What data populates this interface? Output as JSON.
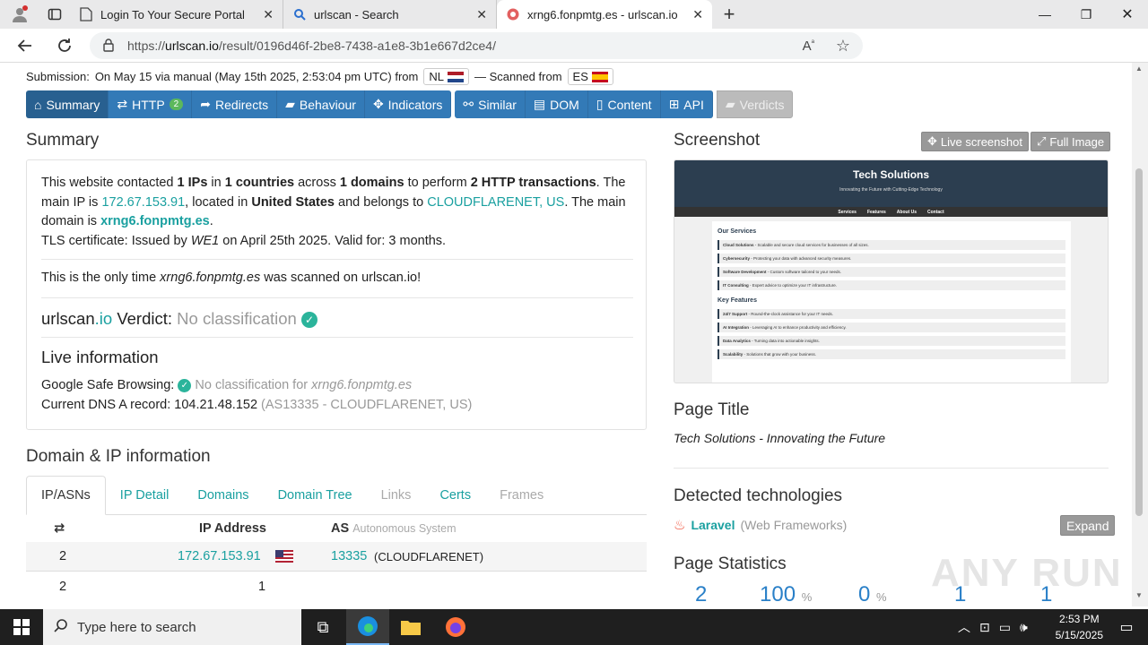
{
  "browser": {
    "tabs": [
      {
        "label": "Login To Your Secure Portal",
        "icon": "page-icon"
      },
      {
        "label": "urlscan - Search",
        "icon": "search-icon"
      },
      {
        "label": "xrng6.fonpmtg.es - urlscan.io",
        "icon": "urlscan-icon"
      }
    ],
    "url_prefix": "https://",
    "url_host": "urlscan.io",
    "url_path": "/result/0196d46f-2be8-7438-a1e8-3b1e667d2ce4/"
  },
  "submission": {
    "label": "Submission:",
    "text": "On May 15 via manual (May 15th 2025, 2:53:04 pm UTC) from",
    "from_country": "NL",
    "scanned_label": "— Scanned from",
    "scanned_country": "ES"
  },
  "nav_buttons": [
    {
      "label": "Summary",
      "icon": "home-icon"
    },
    {
      "label": "HTTP",
      "icon": "exchange-icon",
      "badge": "2"
    },
    {
      "label": "Redirects",
      "icon": "share-icon"
    },
    {
      "label": "Behaviour",
      "icon": "comment-icon"
    },
    {
      "label": "Indicators",
      "icon": "crosshair-icon"
    },
    {
      "label": "Similar",
      "icon": "link-icon"
    },
    {
      "label": "DOM",
      "icon": "list-icon"
    },
    {
      "label": "Content",
      "icon": "file-icon"
    },
    {
      "label": "API",
      "icon": "grid-icon"
    },
    {
      "label": "Verdicts",
      "icon": "comment-icon"
    }
  ],
  "summary": {
    "heading": "Summary",
    "p1_a": "This website contacted ",
    "p1_ips": "1 IPs",
    "p1_b": " in ",
    "p1_countries": "1 countries",
    "p1_c": " across ",
    "p1_domains": "1 domains",
    "p1_d": " to perform ",
    "p1_http": "2 HTTP transactions",
    "p1_e": ". The main IP is ",
    "p1_ip": "172.67.153.91",
    "p1_f": ", located in ",
    "p1_loc": "United States",
    "p1_g": " and belongs to ",
    "p1_asn": "CLOUDFLARENET, US",
    "p1_h": ". The main domain is ",
    "p1_domain": "xrng6.fonpmtg.es",
    "p1_i": ".",
    "tls_a": "TLS certificate: Issued by ",
    "tls_issuer": "WE1",
    "tls_b": " on April 25th 2025. Valid for: 3 months.",
    "only_a": "This is the only time ",
    "only_domain": "xrng6.fonpmtg.es",
    "only_b": " was scanned on urlscan.io!",
    "verdict_brand_a": "urlscan",
    "verdict_brand_b": ".io",
    "verdict_label": " Verdict: ",
    "verdict_value": "No classification",
    "live_heading": "Live information",
    "gsb_label": "Google Safe Browsing:",
    "gsb_value": "No classification for ",
    "gsb_domain": "xrng6.fonpmtg.es",
    "dns_label": "Current DNS A record: ",
    "dns_ip": "104.21.48.152",
    "dns_as": "(AS13335 - CLOUDFLARENET, US)"
  },
  "domain_ip": {
    "heading": "Domain & IP information",
    "tabs": [
      "IP/ASNs",
      "IP Detail",
      "Domains",
      "Domain Tree",
      "Links",
      "Certs",
      "Frames"
    ],
    "col_ip": "IP Address",
    "col_as": "AS",
    "col_as_sub": "Autonomous System",
    "rows": [
      {
        "count": "2",
        "ip": "172.67.153.91",
        "as_num": "13335",
        "as_name": "(CLOUDFLARENET)"
      },
      {
        "count": "2",
        "ip": "1",
        "as_num": "",
        "as_name": ""
      }
    ]
  },
  "screenshot": {
    "heading": "Screenshot",
    "live_btn": "Live screenshot",
    "full_btn": "Full Image",
    "site_title": "Tech Solutions",
    "site_tagline": "Innovating the Future with Cutting-Edge Technology",
    "site_nav": [
      "Services",
      "Features",
      "About Us",
      "Contact"
    ],
    "services_heading": "Our Services",
    "services": [
      {
        "name": "Cloud Solutions",
        "desc": " - Scalable and secure cloud services for businesses of all sizes."
      },
      {
        "name": "Cybersecurity",
        "desc": " - Protecting your data with advanced security measures."
      },
      {
        "name": "Software Development",
        "desc": " - Custom software tailored to your needs."
      },
      {
        "name": "IT Consulting",
        "desc": " - Expert advice to optimize your IT infrastructure."
      }
    ],
    "features_heading": "Key Features",
    "features": [
      {
        "name": "24/7 Support",
        "desc": " - Round-the-clock assistance for your IT needs."
      },
      {
        "name": "AI Integration",
        "desc": " - Leveraging AI to enhance productivity and efficiency."
      },
      {
        "name": "Data Analytics",
        "desc": " - Turning data into actionable insights."
      },
      {
        "name": "Scalability",
        "desc": " - Solutions that grow with your business."
      }
    ]
  },
  "page_title": {
    "heading": "Page Title",
    "value": "Tech Solutions - Innovating the Future"
  },
  "technologies": {
    "heading": "Detected technologies",
    "name": "Laravel",
    "category": "(Web Frameworks)",
    "expand": "Expand"
  },
  "stats": {
    "heading": "Page Statistics",
    "values": [
      {
        "value": "2",
        "unit": ""
      },
      {
        "value": "100",
        "unit": "%"
      },
      {
        "value": "0",
        "unit": "%"
      },
      {
        "value": "1",
        "unit": ""
      },
      {
        "value": "1",
        "unit": ""
      }
    ]
  },
  "watermark": "ANY RUN",
  "taskbar": {
    "search_placeholder": "Type here to search",
    "time": "2:53 PM",
    "date": "5/15/2025"
  },
  "colors": {
    "primary": "#337ab7",
    "link": "#1aa0a0",
    "check": "#2bb49b",
    "stat": "#2a80c8"
  }
}
